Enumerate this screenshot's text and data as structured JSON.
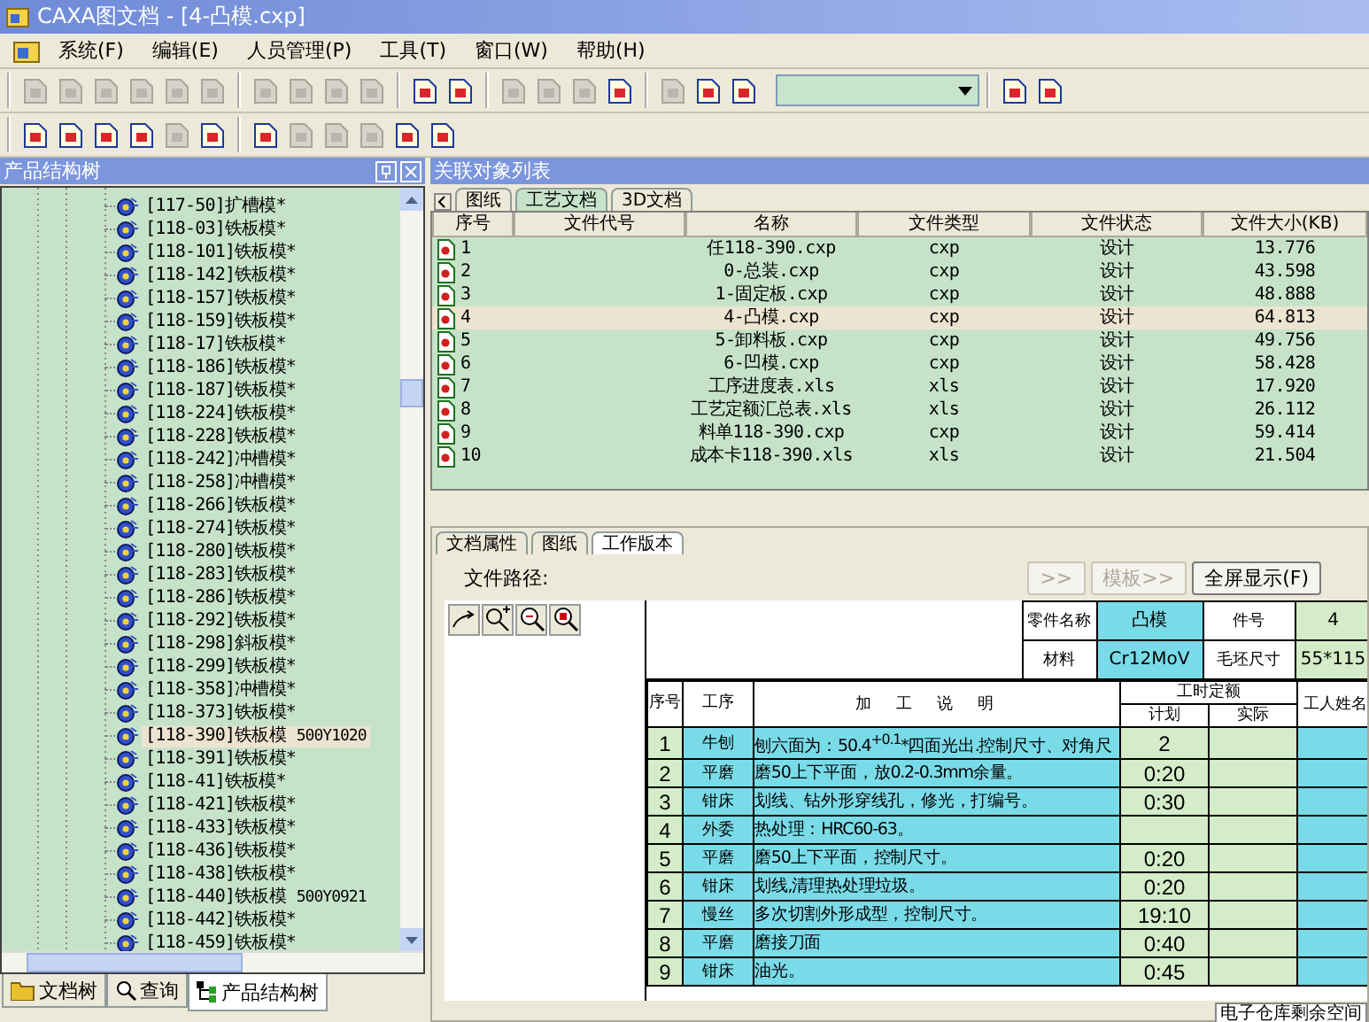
{
  "window": {
    "title": "CAXA图文档 - [4-凸模.cxp]"
  },
  "menu": [
    "系统(F)",
    "编辑(E)",
    "人员管理(P)",
    "工具(T)",
    "窗口(W)",
    "帮助(H)"
  ],
  "toolbars": [
    {
      "groups": [
        [
          {
            "disabled": true
          },
          {
            "disabled": true
          },
          {
            "disabled": true
          },
          {
            "disabled": true
          },
          {
            "disabled": true
          },
          {
            "disabled": true
          }
        ],
        [
          {
            "disabled": true
          },
          {
            "disabled": true
          },
          {
            "disabled": true
          },
          {
            "disabled": true
          }
        ],
        [
          {
            "disabled": false
          },
          {
            "disabled": false
          }
        ],
        [
          {
            "disabled": true
          },
          {
            "disabled": true
          },
          {
            "disabled": true
          },
          {
            "disabled": false
          }
        ],
        [
          {
            "disabled": true
          },
          {
            "disabled": false
          },
          {
            "disabled": false
          }
        ],
        [
          {
            "disabled": false
          },
          {
            "disabled": false
          }
        ]
      ]
    },
    {
      "groups": [
        [
          {
            "disabled": false
          },
          {
            "disabled": false
          },
          {
            "disabled": false
          },
          {
            "disabled": false
          },
          {
            "disabled": true
          },
          {
            "disabled": false
          }
        ],
        [
          {
            "disabled": false
          },
          {
            "disabled": true
          },
          {
            "disabled": true
          },
          {
            "disabled": true
          },
          {
            "disabled": false
          },
          {
            "disabled": false
          }
        ]
      ]
    }
  ],
  "structure_panel": {
    "title": "产品结构树",
    "tree": {
      "items": [
        {
          "label": "[117-50]扩槽模*",
          "selected": false
        },
        {
          "label": "[118-03]铁板模*",
          "selected": false
        },
        {
          "label": "[118-101]铁板模*",
          "selected": false
        },
        {
          "label": "[118-142]铁板模*",
          "selected": false
        },
        {
          "label": "[118-157]铁板模*",
          "selected": false
        },
        {
          "label": "[118-159]铁板模*",
          "selected": false
        },
        {
          "label": "[118-17]铁板模*",
          "selected": false
        },
        {
          "label": "[118-186]铁板模*",
          "selected": false
        },
        {
          "label": "[118-187]铁板模*",
          "selected": false
        },
        {
          "label": "[118-224]铁板模*",
          "selected": false
        },
        {
          "label": "[118-228]铁板模*",
          "selected": false
        },
        {
          "label": "[118-242]冲槽模*",
          "selected": false
        },
        {
          "label": "[118-258]冲槽模*",
          "selected": false
        },
        {
          "label": "[118-266]铁板模*",
          "selected": false
        },
        {
          "label": "[118-274]铁板模*",
          "selected": false
        },
        {
          "label": "[118-280]铁板模*",
          "selected": false
        },
        {
          "label": "[118-283]铁板模*",
          "selected": false
        },
        {
          "label": "[118-286]铁板模*",
          "selected": false
        },
        {
          "label": "[118-292]铁板模*",
          "selected": false
        },
        {
          "label": "[118-298]斜板模*",
          "selected": false
        },
        {
          "label": "[118-299]铁板模*",
          "selected": false
        },
        {
          "label": "[118-358]冲槽模*",
          "selected": false
        },
        {
          "label": "[118-373]铁板模*",
          "selected": false
        },
        {
          "label": "[118-390]铁板模",
          "code": "500Y1020",
          "selected": true
        },
        {
          "label": "[118-391]铁板模*",
          "selected": false
        },
        {
          "label": "[118-41]铁板模*",
          "selected": false
        },
        {
          "label": "[118-421]铁板模*",
          "selected": false
        },
        {
          "label": "[118-433]铁板模*",
          "selected": false
        },
        {
          "label": "[118-436]铁板模*",
          "selected": false
        },
        {
          "label": "[118-438]铁板模*",
          "selected": false
        },
        {
          "label": "[118-440]铁板模",
          "code": "500Y0921",
          "selected": false
        },
        {
          "label": "[118-442]铁板模*",
          "selected": false
        },
        {
          "label": "[118-459]铁板模*",
          "selected": false
        }
      ]
    },
    "tabs": [
      {
        "label": "文档树",
        "selected": false
      },
      {
        "label": "查询",
        "selected": false
      },
      {
        "label": "产品结构树",
        "selected": true
      }
    ]
  },
  "related_panel": {
    "title": "关联对象列表",
    "tabs": [
      {
        "label": "图纸",
        "selected": false
      },
      {
        "label": "工艺文档",
        "selected": true
      },
      {
        "label": "3D文档",
        "selected": false
      }
    ],
    "table": {
      "columns": [
        "序号",
        "文件代号",
        "名称",
        "文件类型",
        "文件状态",
        "文件大小(KB)"
      ],
      "rows": [
        {
          "no": "1",
          "name": "任118-390.cxp",
          "type": "cxp",
          "status": "设计",
          "size": "13.776",
          "selected": false
        },
        {
          "no": "2",
          "name": "0-总装.cxp",
          "type": "cxp",
          "status": "设计",
          "size": "43.598",
          "selected": false
        },
        {
          "no": "3",
          "name": "1-固定板.cxp",
          "type": "cxp",
          "status": "设计",
          "size": "48.888",
          "selected": false
        },
        {
          "no": "4",
          "name": "4-凸模.cxp",
          "type": "cxp",
          "status": "设计",
          "size": "64.813",
          "selected": true
        },
        {
          "no": "5",
          "name": "5-卸料板.cxp",
          "type": "cxp",
          "status": "设计",
          "size": "49.756",
          "selected": false
        },
        {
          "no": "6",
          "name": "6-凹模.cxp",
          "type": "cxp",
          "status": "设计",
          "size": "58.428",
          "selected": false
        },
        {
          "no": "7",
          "name": "工序进度表.xls",
          "type": "xls",
          "status": "设计",
          "size": "17.920",
          "selected": false
        },
        {
          "no": "8",
          "name": "工艺定额汇总表.xls",
          "type": "xls",
          "status": "设计",
          "size": "26.112",
          "selected": false
        },
        {
          "no": "9",
          "name": "料单118-390.cxp",
          "type": "cxp",
          "status": "设计",
          "size": "59.414",
          "selected": false
        },
        {
          "no": "10",
          "name": "成本卡118-390.xls",
          "type": "xls",
          "status": "设计",
          "size": "21.504",
          "selected": false
        }
      ]
    }
  },
  "document_panel": {
    "tabs": [
      {
        "label": "文档属性",
        "selected": false
      },
      {
        "label": "图纸",
        "selected": false
      },
      {
        "label": "工作版本",
        "selected": true
      }
    ],
    "path_label": "文件路径:",
    "buttons": [
      {
        "label": ">>",
        "disabled": true
      },
      {
        "label": "模板>>",
        "disabled": true
      },
      {
        "label": "全屏显示(F)",
        "disabled": false
      }
    ],
    "process_card": {
      "info_rows": [
        [
          {
            "label": "零件名称",
            "value": "凸模"
          },
          {
            "label": "件号",
            "value": "4"
          }
        ],
        [
          {
            "label": "材料",
            "value": "Cr12MoV"
          },
          {
            "label": "毛坯尺寸",
            "value": "55*115"
          }
        ]
      ],
      "columns": {
        "no": "序号",
        "process": "工序",
        "description": "加工说明",
        "time_quota": "工时定额",
        "planned": "计划",
        "actual": "实际",
        "worker": "工人姓名"
      },
      "rows": [
        {
          "no": "1",
          "process": "牛刨",
          "description": "刨六面为：50.4$^{+0.1}$*四面光出.控制尺寸、对角尺",
          "planned": "2"
        },
        {
          "no": "2",
          "process": "平磨",
          "description": "磨50上下平面，放0.2-0.3mm余量。",
          "planned": "0:20"
        },
        {
          "no": "3",
          "process": "钳床",
          "description": "划线、钻外形穿线孔，修光，打编号。",
          "planned": "0:30"
        },
        {
          "no": "4",
          "process": "外委",
          "description": "热处理：HRC60-63。"
        },
        {
          "no": "5",
          "process": "平磨",
          "description": "磨50上下平面，控制尺寸。",
          "planned": "0:20"
        },
        {
          "no": "6",
          "process": "钳床",
          "description": "划线,清理热处理垃圾。",
          "planned": "0:20"
        },
        {
          "no": "7",
          "process": "慢丝",
          "description": "多次切割外形成型，控制尺寸。",
          "planned": "19:10"
        },
        {
          "no": "8",
          "process": "平磨",
          "description": "磨接刀面",
          "planned": "0:40"
        },
        {
          "no": "9",
          "process": "钳床",
          "description": "油光。",
          "planned": "0:45"
        }
      ]
    }
  },
  "status_bar": {
    "text": "电子仓库剩余空间"
  }
}
